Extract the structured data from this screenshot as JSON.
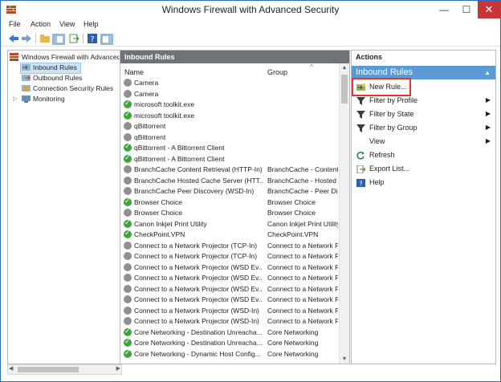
{
  "window": {
    "title": "Windows Firewall with Advanced Security"
  },
  "menu": [
    "File",
    "Action",
    "View",
    "Help"
  ],
  "tree": {
    "root": "Windows Firewall with Advanced Security",
    "items": [
      "Inbound Rules",
      "Outbound Rules",
      "Connection Security Rules",
      "Monitoring"
    ]
  },
  "middle": {
    "header": "Inbound Rules",
    "columns": {
      "name": "Name",
      "group": "Group"
    },
    "rows": [
      {
        "name": "Camera",
        "group": "",
        "enabled": false
      },
      {
        "name": "Camera",
        "group": "",
        "enabled": false
      },
      {
        "name": "microsoft toolkit.exe",
        "group": "",
        "enabled": true
      },
      {
        "name": "microsoft toolkit.exe",
        "group": "",
        "enabled": true
      },
      {
        "name": "qBittorrent",
        "group": "",
        "enabled": false
      },
      {
        "name": "qBittorrent",
        "group": "",
        "enabled": false
      },
      {
        "name": "qBittorrent - A Bittorrent Client",
        "group": "",
        "enabled": true
      },
      {
        "name": "qBittorrent - A Bittorrent Client",
        "group": "",
        "enabled": true
      },
      {
        "name": "BranchCache Content Retrieval (HTTP-In)",
        "group": "BranchCache - Content",
        "enabled": false
      },
      {
        "name": "BranchCache Hosted Cache Server (HTT...",
        "group": "BranchCache - Hosted C",
        "enabled": false
      },
      {
        "name": "BranchCache Peer Discovery (WSD-In)",
        "group": "BranchCache - Peer Dis",
        "enabled": false
      },
      {
        "name": "Browser Choice",
        "group": "Browser Choice",
        "enabled": true
      },
      {
        "name": "Browser Choice",
        "group": "Browser Choice",
        "enabled": false
      },
      {
        "name": "Canon Inkjet Print Utility",
        "group": "Canon Inkjet Print Utility",
        "enabled": true
      },
      {
        "name": "CheckPoint.VPN",
        "group": "CheckPoint.VPN",
        "enabled": true
      },
      {
        "name": "Connect to a Network Projector (TCP-In)",
        "group": "Connect to a Network P",
        "enabled": false
      },
      {
        "name": "Connect to a Network Projector (TCP-In)",
        "group": "Connect to a Network P",
        "enabled": false
      },
      {
        "name": "Connect to a Network Projector (WSD Ev...",
        "group": "Connect to a Network P",
        "enabled": false
      },
      {
        "name": "Connect to a Network Projector (WSD Ev...",
        "group": "Connect to a Network P",
        "enabled": false
      },
      {
        "name": "Connect to a Network Projector (WSD Ev...",
        "group": "Connect to a Network P",
        "enabled": false
      },
      {
        "name": "Connect to a Network Projector (WSD Ev...",
        "group": "Connect to a Network P",
        "enabled": false
      },
      {
        "name": "Connect to a Network Projector (WSD-In)",
        "group": "Connect to a Network P",
        "enabled": false
      },
      {
        "name": "Connect to a Network Projector (WSD-In)",
        "group": "Connect to a Network P",
        "enabled": false
      },
      {
        "name": "Core Networking - Destination Unreacha...",
        "group": "Core Networking",
        "enabled": true
      },
      {
        "name": "Core Networking - Destination Unreacha...",
        "group": "Core Networking",
        "enabled": true
      },
      {
        "name": "Core Networking - Dynamic Host Config...",
        "group": "Core Networking",
        "enabled": true
      }
    ]
  },
  "actions": {
    "header": "Actions",
    "section": "Inbound Rules",
    "items": [
      {
        "label": "New Rule...",
        "submenu": false,
        "icon": "new-rule-icon"
      },
      {
        "label": "Filter by Profile",
        "submenu": true,
        "icon": "filter-icon"
      },
      {
        "label": "Filter by State",
        "submenu": true,
        "icon": "filter-icon"
      },
      {
        "label": "Filter by Group",
        "submenu": true,
        "icon": "filter-icon"
      },
      {
        "label": "View",
        "submenu": true,
        "icon": ""
      },
      {
        "label": "Refresh",
        "submenu": false,
        "icon": "refresh-icon"
      },
      {
        "label": "Export List...",
        "submenu": false,
        "icon": "export-icon"
      },
      {
        "label": "Help",
        "submenu": false,
        "icon": "help-icon"
      }
    ]
  },
  "colors": {
    "accent": "#5b9bd5",
    "highlight": "#e8342c",
    "enabled": "#3ea53a",
    "disabled": "#8f8f8f"
  }
}
